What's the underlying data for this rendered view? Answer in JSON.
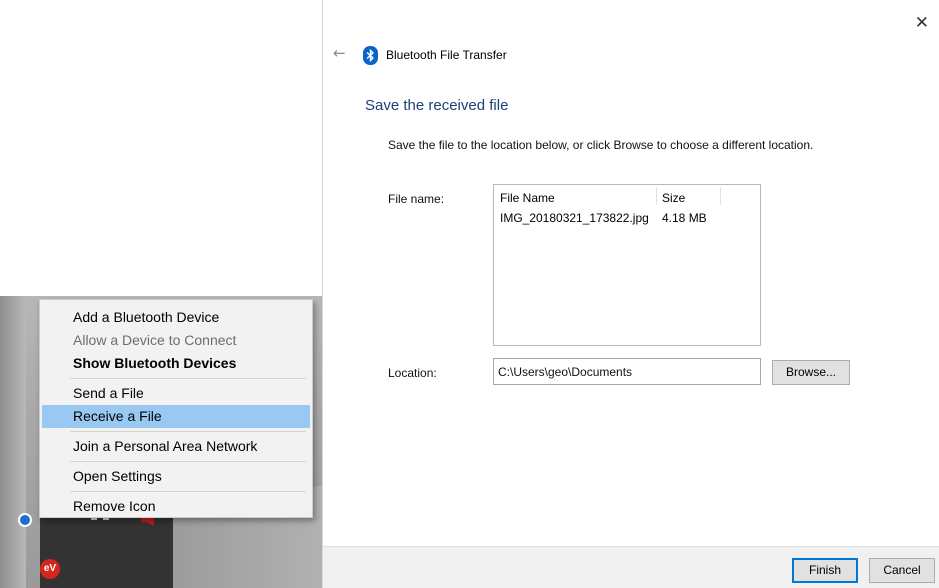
{
  "tray_menu": {
    "items": [
      {
        "label": "Add a Bluetooth Device",
        "state": "normal"
      },
      {
        "label": "Allow a Device to Connect",
        "state": "disabled"
      },
      {
        "label": "Show Bluetooth Devices",
        "state": "bold"
      },
      {
        "label": "Send a File",
        "state": "normal"
      },
      {
        "label": "Receive a File",
        "state": "hover"
      },
      {
        "label": "Join a Personal Area Network",
        "state": "normal"
      },
      {
        "label": "Open Settings",
        "state": "normal"
      },
      {
        "label": "Remove Icon",
        "state": "normal"
      }
    ],
    "hover_color": "#99c9f3"
  },
  "tray": {
    "icons": [
      "bluetooth-icon",
      "network-icon",
      "volume-icon",
      "antivirus-icon"
    ],
    "antivirus_text": "eV"
  },
  "wizard": {
    "title": "Bluetooth File Transfer",
    "heading": "Save the received file",
    "instruction": "Save the file to the location below, or click Browse to choose a different location.",
    "file_name_label": "File name:",
    "file_table": {
      "columns": [
        "File Name",
        "Size"
      ],
      "rows": [
        [
          "IMG_20180321_173822.jpg",
          "4.18 MB"
        ]
      ]
    },
    "location_label": "Location:",
    "location_value": "C:\\Users\\geo\\Documents",
    "browse_label": "Browse...",
    "finish_label": "Finish",
    "cancel_label": "Cancel",
    "heading_color": "#1e3f7a",
    "accent_color": "#0078d7"
  }
}
